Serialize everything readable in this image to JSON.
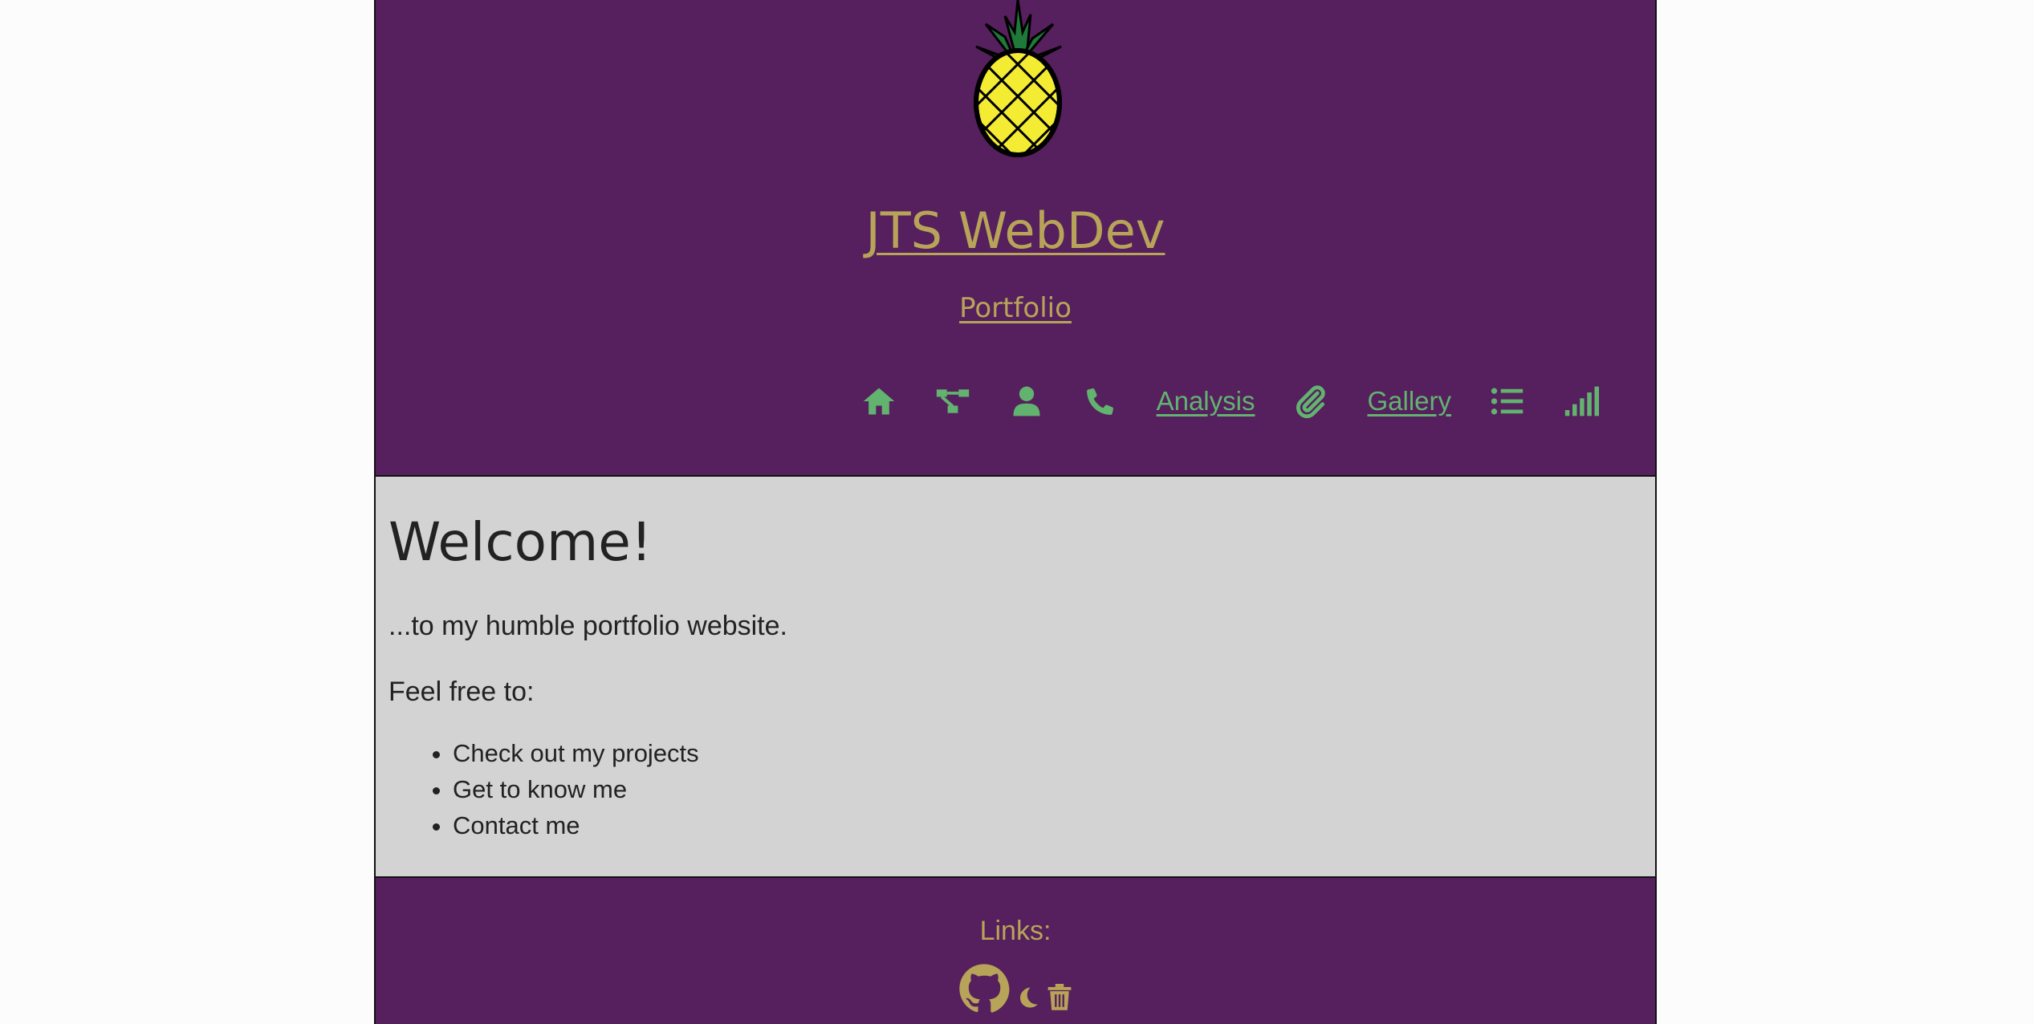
{
  "header": {
    "title": "JTS WebDev",
    "subtitle": "Portfolio"
  },
  "nav": {
    "items": [
      {
        "icon": "home-icon"
      },
      {
        "icon": "sitemap-icon"
      },
      {
        "icon": "user-icon"
      },
      {
        "icon": "phone-icon"
      },
      {
        "label": "Analysis"
      },
      {
        "icon": "paperclip-icon"
      },
      {
        "label": "Gallery"
      },
      {
        "icon": "list-icon"
      },
      {
        "icon": "signal-icon"
      }
    ],
    "analysis_label": "Analysis",
    "gallery_label": "Gallery"
  },
  "main": {
    "heading": "Welcome!",
    "intro": "...to my humble portfolio website.",
    "prompt": "Feel free to:",
    "items": [
      "Check out my projects",
      "Get to know me",
      "Contact me"
    ]
  },
  "footer": {
    "links_label": "Links:",
    "icons": [
      "github-icon",
      "moon-icon",
      "trash-icon"
    ]
  },
  "colors": {
    "purple": "#561f5d",
    "gold": "#b7a459",
    "green": "#62b36f",
    "content_bg": "#d3d3d3"
  }
}
